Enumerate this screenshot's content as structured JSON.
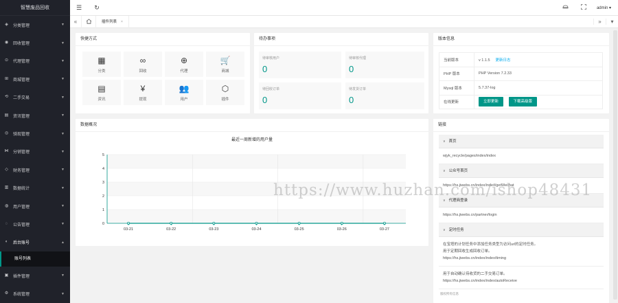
{
  "app": {
    "title": "智慧废品回收"
  },
  "sidebar": {
    "items": [
      {
        "label": "分类管理",
        "icon": "tag-icon"
      },
      {
        "label": "回收管理",
        "icon": "recycle-icon"
      },
      {
        "label": "代理管理",
        "icon": "agent-icon"
      },
      {
        "label": "商城管理",
        "icon": "shop-icon"
      },
      {
        "label": "二手交易",
        "icon": "trade-icon"
      },
      {
        "label": "资讯管理",
        "icon": "news-icon"
      },
      {
        "label": "骑现管理",
        "icon": "rider-icon"
      },
      {
        "label": "分销管理",
        "icon": "share-icon"
      },
      {
        "label": "财务管理",
        "icon": "finance-icon"
      },
      {
        "label": "数据统计",
        "icon": "stats-icon"
      },
      {
        "label": "用户管理",
        "icon": "user-icon"
      },
      {
        "label": "公告管理",
        "icon": "notice-icon"
      },
      {
        "label": "后台账号",
        "icon": "account-icon",
        "expanded": true
      }
    ],
    "sub_item": "账号列表",
    "items_after": [
      {
        "label": "插件管理",
        "icon": "plugin-icon"
      },
      {
        "label": "系统管理",
        "icon": "gear-icon"
      }
    ]
  },
  "header": {
    "menu_icon": "☰",
    "refresh_icon": "↻",
    "user": "admin"
  },
  "tabs": {
    "items": [
      {
        "label": "插件列表"
      }
    ]
  },
  "quick": {
    "title": "快捷方式",
    "items": [
      {
        "label": "分类",
        "glyph": "▦"
      },
      {
        "label": "回收",
        "glyph": "∞"
      },
      {
        "label": "代理",
        "glyph": "⊕"
      },
      {
        "label": "商城",
        "glyph": "🛒"
      },
      {
        "label": "资讯",
        "glyph": "▤"
      },
      {
        "label": "提现",
        "glyph": "¥"
      },
      {
        "label": "用户",
        "glyph": "👥"
      },
      {
        "label": "插件",
        "glyph": "⬡"
      }
    ]
  },
  "pending": {
    "title": "待办事项",
    "items": [
      {
        "label": "待审核用户",
        "value": "0"
      },
      {
        "label": "待审核代理",
        "value": "0"
      },
      {
        "label": "待回收订单",
        "value": "0"
      },
      {
        "label": "待发货订单",
        "value": "0"
      }
    ]
  },
  "version": {
    "title": "版本信息",
    "rows": [
      {
        "key": "当前版本",
        "value": "v 1.1.5",
        "link": "更新日志"
      },
      {
        "key": "PHP 版本",
        "value": "PHP Version 7.2.33"
      },
      {
        "key": "Mysql 版本",
        "value": "5.7.37-log"
      },
      {
        "key": "在线更新"
      }
    ],
    "btn_update": "立即更新",
    "btn_download": "下载高级版"
  },
  "chart_panel": {
    "title": "数据概况"
  },
  "chart_data": {
    "type": "line",
    "title": "最近一周新增的用户量",
    "categories": [
      "03-21",
      "03-22",
      "03-23",
      "03-24",
      "03-25",
      "03-26",
      "03-27"
    ],
    "values": [
      0,
      0,
      0,
      0,
      0,
      0,
      0
    ],
    "ylim": [
      0,
      5
    ],
    "yticks": [
      "0",
      "1",
      "2",
      "3",
      "4",
      "5"
    ],
    "color": "#009688",
    "grid": true
  },
  "links": {
    "title": "链接",
    "groups": [
      {
        "header": "首页",
        "lines": [
          "wjyk_recycle/pages/index/index"
        ]
      },
      {
        "header": "公众号首页",
        "lines": [
          "https://hs.jiwebs.cn/index/index/getWechat"
        ]
      },
      {
        "header": "代理商登录",
        "lines": [
          "https://hs.jiwebs.cn/partner/login"
        ]
      },
      {
        "header": "定时任务",
        "lines": [
          "在宝塔的计划任务中添加任务类型为访问url的定时任务。",
          "用于定期回收生成回收订单。",
          "https://hs.jiwebs.cn/index/index/timing"
        ]
      },
      {
        "header": "",
        "lines": [
          "用于自动确认待收货的二手交易订单。",
          "https://hs.jiwebs.cn/index/index/autoReceive"
        ]
      }
    ],
    "footer": "版权所有信息"
  },
  "watermark": "https://www.huzhan.com/ishop48431"
}
